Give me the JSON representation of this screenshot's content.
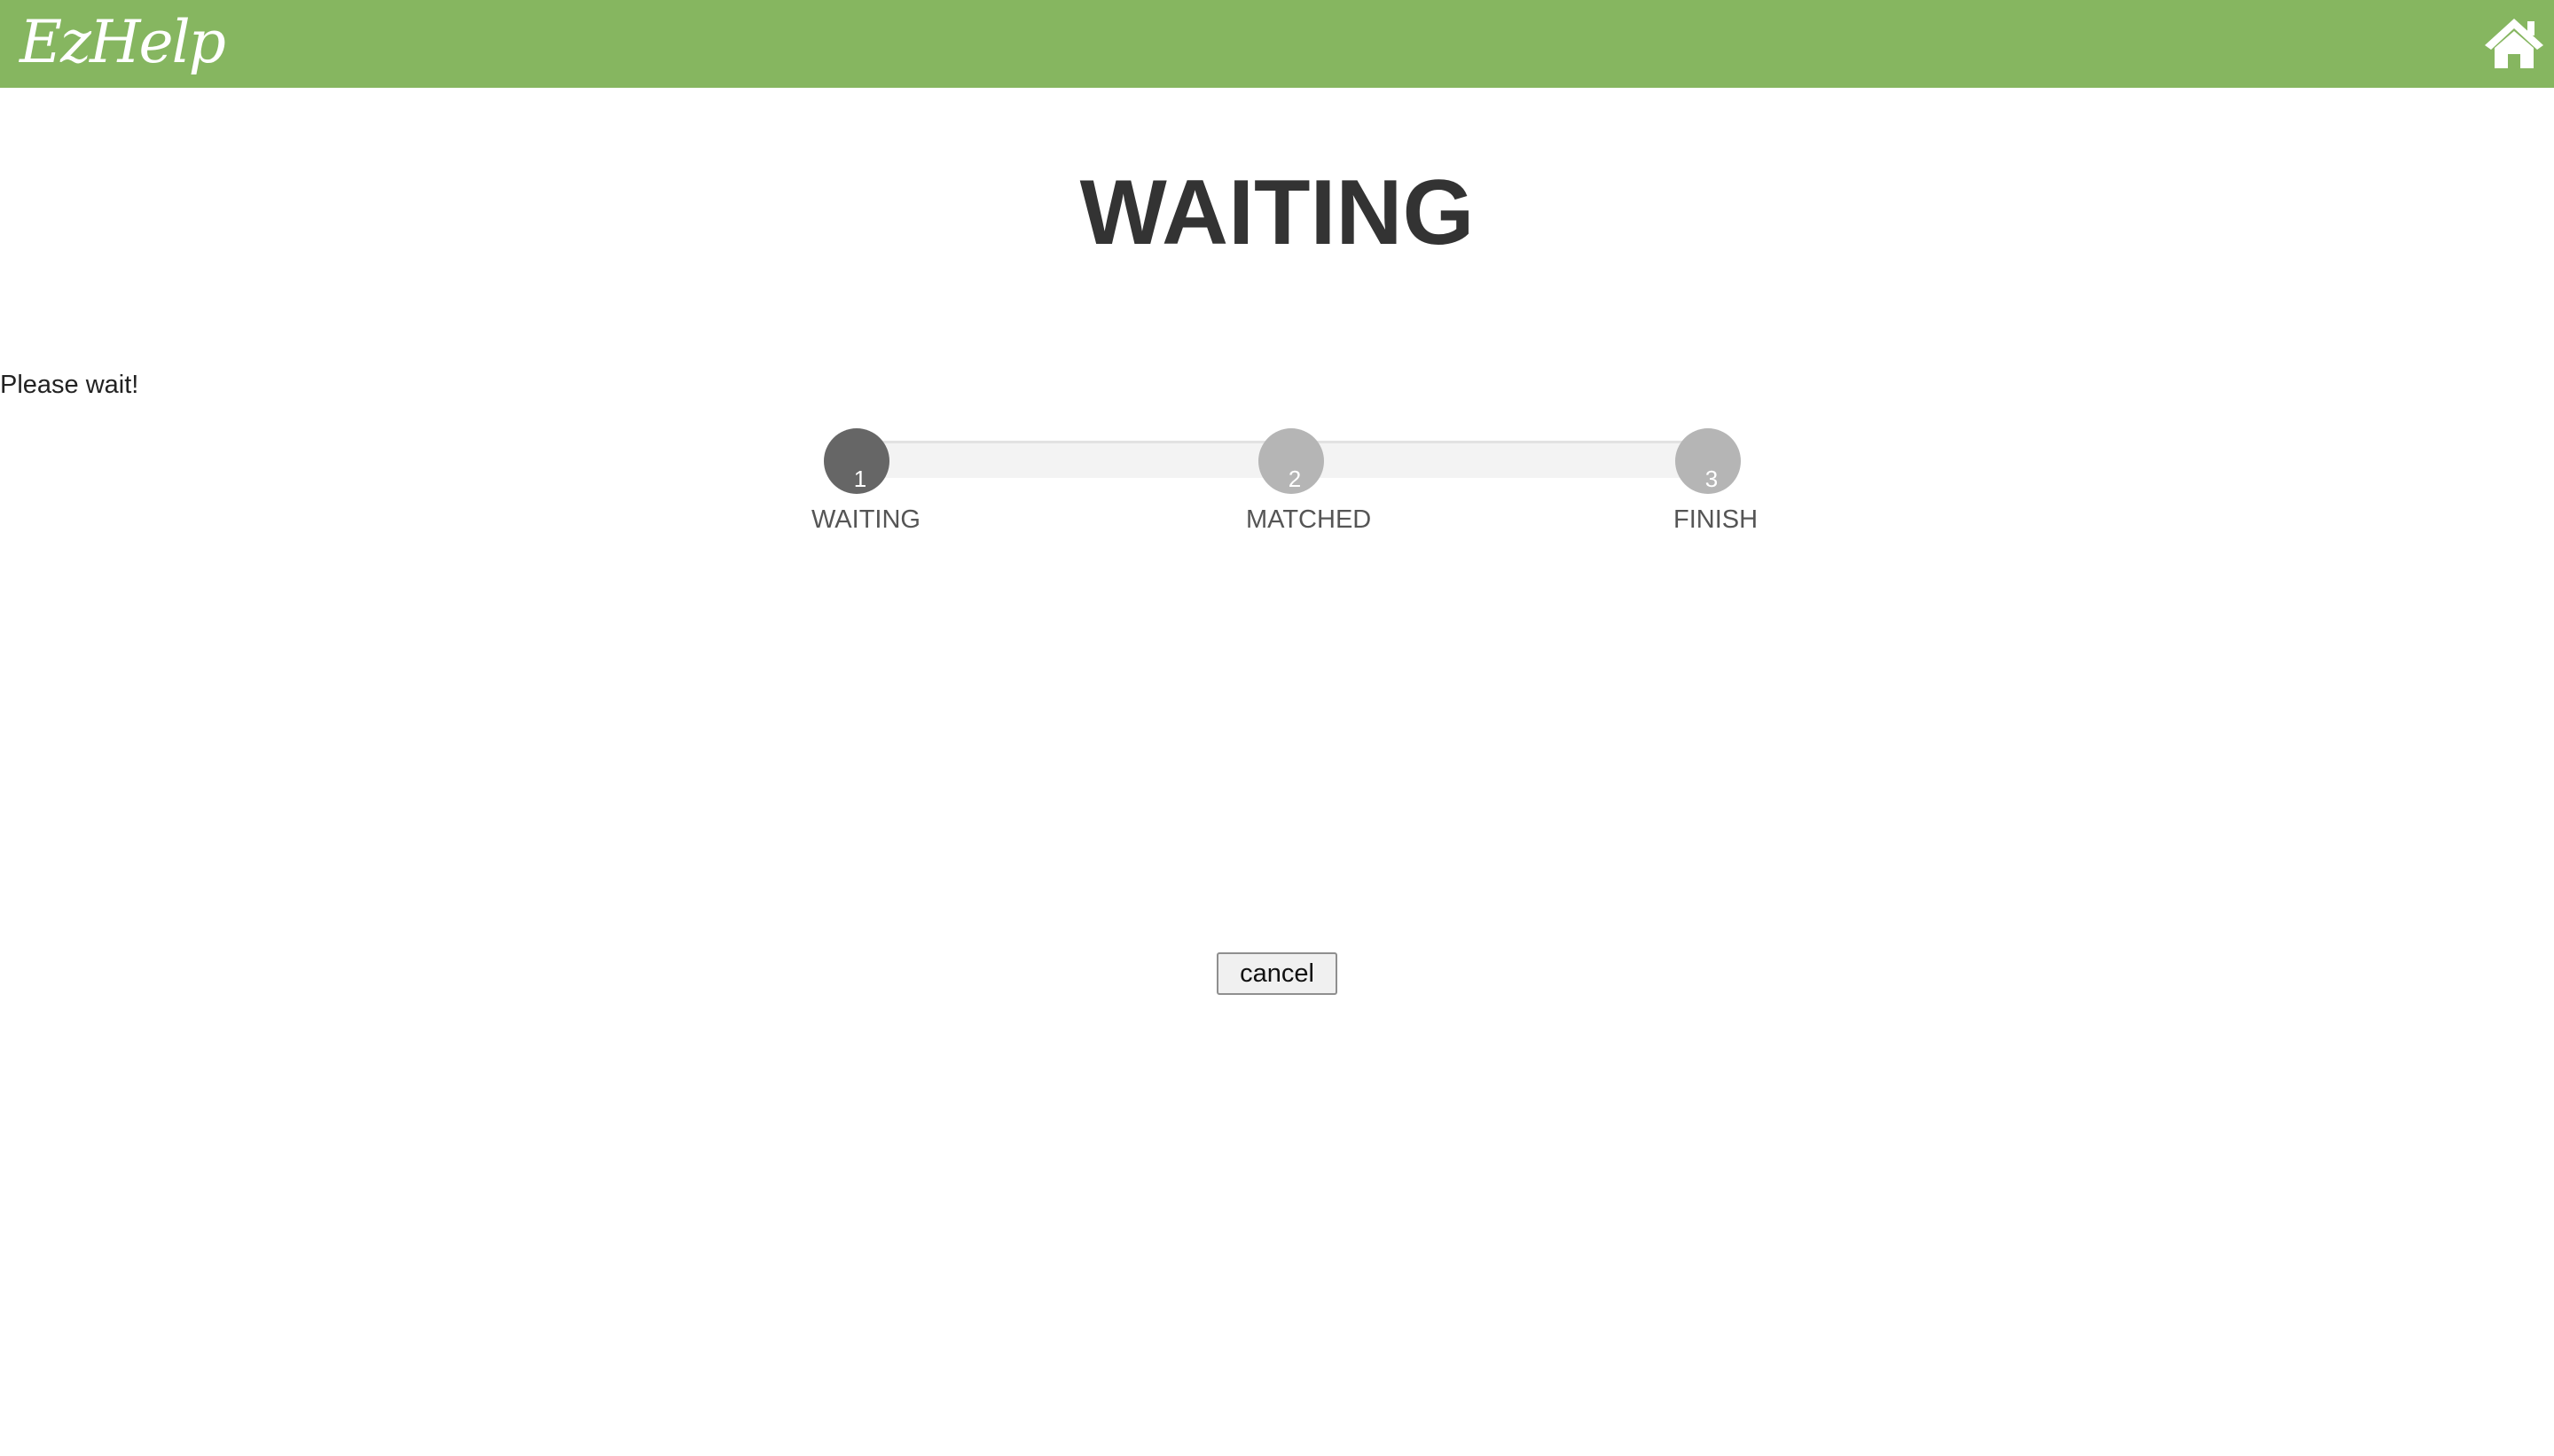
{
  "header": {
    "logo_text": "EzHelp",
    "home_icon": "home-icon",
    "background_color": "#86b660"
  },
  "main": {
    "title": "WAITING",
    "status_text": "Please wait!"
  },
  "progress": {
    "current_step": 1,
    "steps": [
      {
        "number": "1",
        "label": "WAITING",
        "state": "active"
      },
      {
        "number": "2",
        "label": "MATCHED",
        "state": "inactive"
      },
      {
        "number": "3",
        "label": "FINISH",
        "state": "inactive"
      }
    ],
    "active_color": "#666666",
    "inactive_color": "#b5b5b5"
  },
  "actions": {
    "cancel_label": "cancel"
  }
}
